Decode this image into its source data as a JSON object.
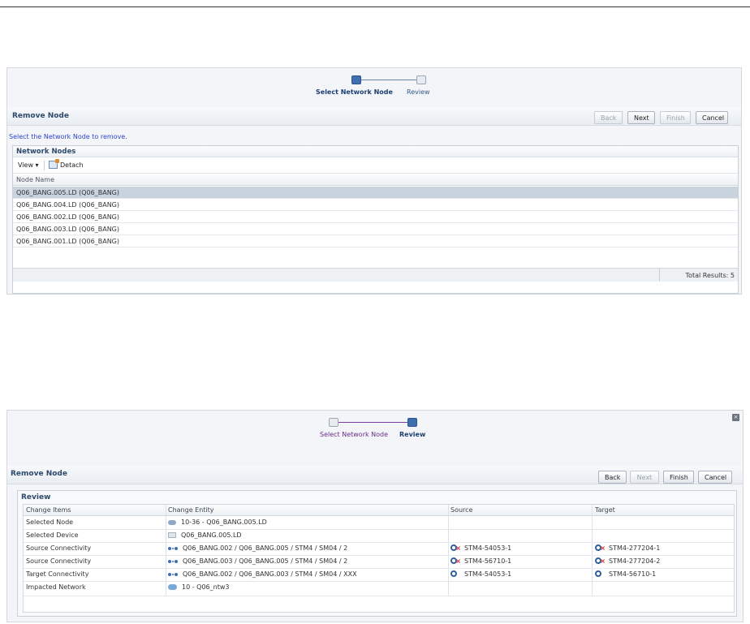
{
  "screen1": {
    "train": {
      "steps": [
        "Select Network Node",
        "Review"
      ]
    },
    "title": "Remove Node",
    "buttons": {
      "back": "Back",
      "next": "Next",
      "finish": "Finish",
      "cancel": "Cancel"
    },
    "instruction": "Select the Network Node to remove.",
    "table": {
      "title": "Network Nodes",
      "toolbar": {
        "view": "View",
        "detach": "Detach"
      },
      "column": "Node Name",
      "rows": [
        "Q06_BANG.005.LD (Q06_BANG)",
        "Q06_BANG.004.LD (Q06_BANG)",
        "Q06_BANG.002.LD (Q06_BANG)",
        "Q06_BANG.003.LD (Q06_BANG)",
        "Q06_BANG.001.LD (Q06_BANG)"
      ],
      "total": "Total Results: 5"
    }
  },
  "screen2": {
    "train": {
      "steps": [
        "Select Network Node",
        "Review"
      ]
    },
    "title": "Remove Node",
    "buttons": {
      "back": "Back",
      "next": "Next",
      "finish": "Finish",
      "cancel": "Cancel"
    },
    "review": {
      "title": "Review",
      "columns": [
        "Change Items",
        "Change Entity",
        "Source",
        "Target"
      ],
      "rows": [
        {
          "item": "Selected Node",
          "entity": "10-36 - Q06_BANG.005.LD",
          "source": "",
          "target": ""
        },
        {
          "item": "Selected Device",
          "entity": "Q06_BANG.005.LD",
          "source": "",
          "target": ""
        },
        {
          "item": "Source Connectivity",
          "entity": "Q06_BANG.002 / Q06_BANG.005 / STM4 / SM04 / 2",
          "source": "STM4-54053-1",
          "target": "STM4-277204-1"
        },
        {
          "item": "Source Connectivity",
          "entity": "Q06_BANG.003 / Q06_BANG.005 / STM4 / SM04 / 2",
          "source": "STM4-56710-1",
          "target": "STM4-277204-2"
        },
        {
          "item": "Target Connectivity",
          "entity": "Q06_BANG.002 / Q06_BANG.003 / STM4 / SM04 / XXX",
          "source": "STM4-54053-1",
          "target": "STM4-56710-1"
        },
        {
          "item": "Impacted Network",
          "entity": "10 - Q06_ntw3",
          "source": "",
          "target": ""
        }
      ]
    }
  }
}
